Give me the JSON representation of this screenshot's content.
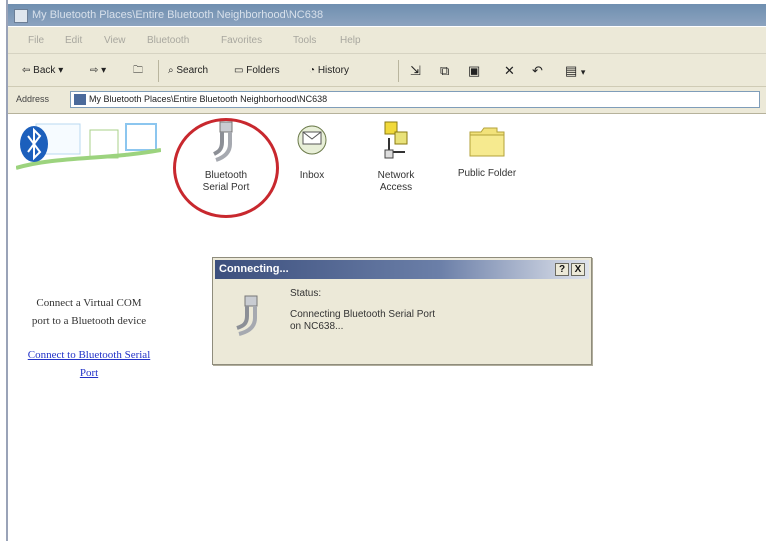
{
  "window": {
    "title": "My Bluetooth Places\\Entire Bluetooth Neighborhood\\NC638"
  },
  "menu": [
    "File",
    "Edit",
    "View",
    "Bluetooth",
    "Favorites",
    "Tools",
    "Help"
  ],
  "toolbar": {
    "back_label": "Back",
    "search_label": "Search",
    "folders_label": "Folders",
    "history_label": "History"
  },
  "address": {
    "label": "Address",
    "path": "My Bluetooth Places\\Entire Bluetooth Neighborhood\\NC638"
  },
  "items": [
    {
      "label_line1": "Bluetooth",
      "label_line2": "Serial Port",
      "icon": "serial-port-icon"
    },
    {
      "label_line1": "Inbox",
      "label_line2": "",
      "icon": "inbox-icon"
    },
    {
      "label_line1": "Network",
      "label_line2": "Access",
      "icon": "network-access-icon"
    },
    {
      "label_line1": "Public Folder",
      "label_line2": "",
      "icon": "folder-icon"
    }
  ],
  "task": {
    "description_line1": "Connect a Virtual COM",
    "description_line2": "port to a Bluetooth device",
    "link_line1": "Connect to Bluetooth Serial",
    "link_line2": "Port"
  },
  "dialog": {
    "title": "Connecting...",
    "help_button": "?",
    "close_button": "X",
    "status_label": "Status:",
    "message_line1": "Connecting Bluetooth Serial Port",
    "message_line2": "on NC638..."
  },
  "colors": {
    "highlight_circle": "#c8282e",
    "link": "#2333c8",
    "dialog_title_start": "#3c4f7d"
  }
}
